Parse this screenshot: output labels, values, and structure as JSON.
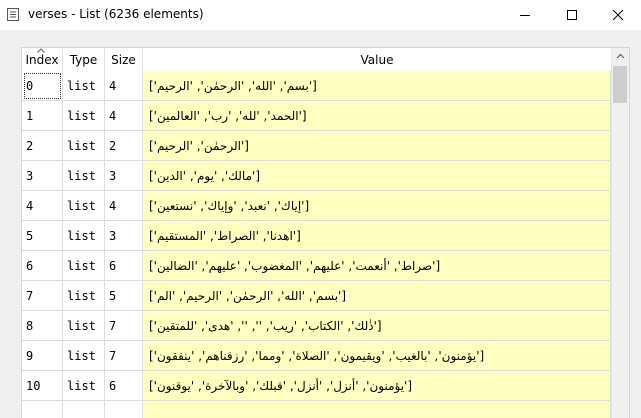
{
  "window": {
    "title": "verses - List (6236 elements)",
    "icon": "list-window-icon",
    "controls": [
      "minimize-icon",
      "maximize-icon",
      "close-icon"
    ]
  },
  "table": {
    "columns": [
      "Index",
      "Type",
      "Size",
      "Value"
    ],
    "sort_indicator": "ascending-arrow",
    "rows": [
      {
        "index": "0",
        "type": "list",
        "size": "4",
        "value": "['بسم', 'الله', 'الرحمٰن', 'الرحيم']"
      },
      {
        "index": "1",
        "type": "list",
        "size": "4",
        "value": "['الحمد', 'لله', 'رب', 'العالمين']"
      },
      {
        "index": "2",
        "type": "list",
        "size": "2",
        "value": "['الرحمٰن', 'الرحيم']"
      },
      {
        "index": "3",
        "type": "list",
        "size": "3",
        "value": "['مالك', 'يوم', 'الدين']"
      },
      {
        "index": "4",
        "type": "list",
        "size": "4",
        "value": "['إياك', 'نعبد', 'وإياك', 'نستعين']"
      },
      {
        "index": "5",
        "type": "list",
        "size": "3",
        "value": "['اهدنا', 'الصراط', 'المستقيم']"
      },
      {
        "index": "6",
        "type": "list",
        "size": "6",
        "value": "['صراط', 'أنعمت', 'عليهم', 'المغضوب', 'عليهم', 'الضالين']"
      },
      {
        "index": "7",
        "type": "list",
        "size": "5",
        "value": "['بسم', 'الله', 'الرحمٰن', 'الرحيم', 'الم']"
      },
      {
        "index": "8",
        "type": "list",
        "size": "7",
        "value": "['ذٰلك', 'الكتاب', 'ريب', '', '', 'هدى', 'للمتقين']"
      },
      {
        "index": "9",
        "type": "list",
        "size": "7",
        "value": "['يؤمنون', 'بالغيب', 'ويقيمون', 'الصلاة', 'ومما', 'رزقناهم', 'ينفقون']"
      },
      {
        "index": "10",
        "type": "list",
        "size": "6",
        "value": "['يؤمنون', 'أنزل', 'أنزل', 'قبلك', 'وبالآخرة', 'يوقنون']"
      }
    ]
  },
  "colors": {
    "value_background": "#ffffc0",
    "scroll_thumb": "#cdcdcd"
  }
}
